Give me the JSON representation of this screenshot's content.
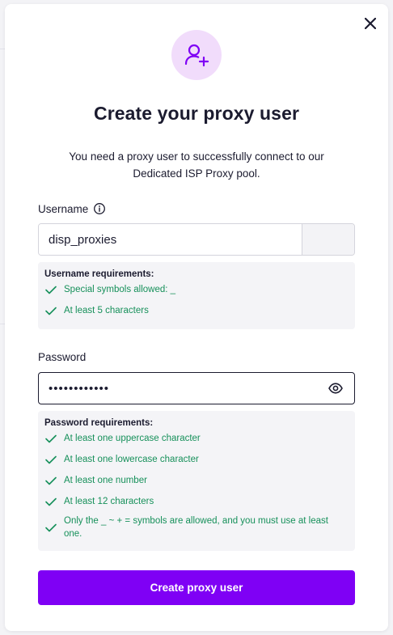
{
  "modal": {
    "close_icon": "close-icon",
    "avatar_icon": "user-add-icon",
    "title": "Create your proxy user",
    "subtitle": "You need a proxy user to successfully connect to our Dedicated ISP Proxy pool."
  },
  "username": {
    "label": "Username",
    "info_icon": "info-icon",
    "value": "disp_proxies",
    "requirements_title": "Username requirements:",
    "requirements": [
      {
        "text": "Special symbols allowed: _",
        "met": true
      },
      {
        "text": "At least 5 characters",
        "met": true
      }
    ]
  },
  "password": {
    "label": "Password",
    "value": "••••••••••••",
    "visibility_icon": "eye-icon",
    "requirements_title": "Password requirements:",
    "requirements": [
      {
        "text": "At least one uppercase character",
        "met": true
      },
      {
        "text": "At least one lowercase character",
        "met": true
      },
      {
        "text": "At least one number",
        "met": true
      },
      {
        "text": "At least 12 characters",
        "met": true
      },
      {
        "text": "Only the _ ~ + = symbols are allowed, and you must use at least one.",
        "met": true
      }
    ]
  },
  "submit_label": "Create proxy user",
  "colors": {
    "accent": "#7f00f5",
    "success": "#16905a",
    "avatar_bg": "#f1dcfb"
  }
}
